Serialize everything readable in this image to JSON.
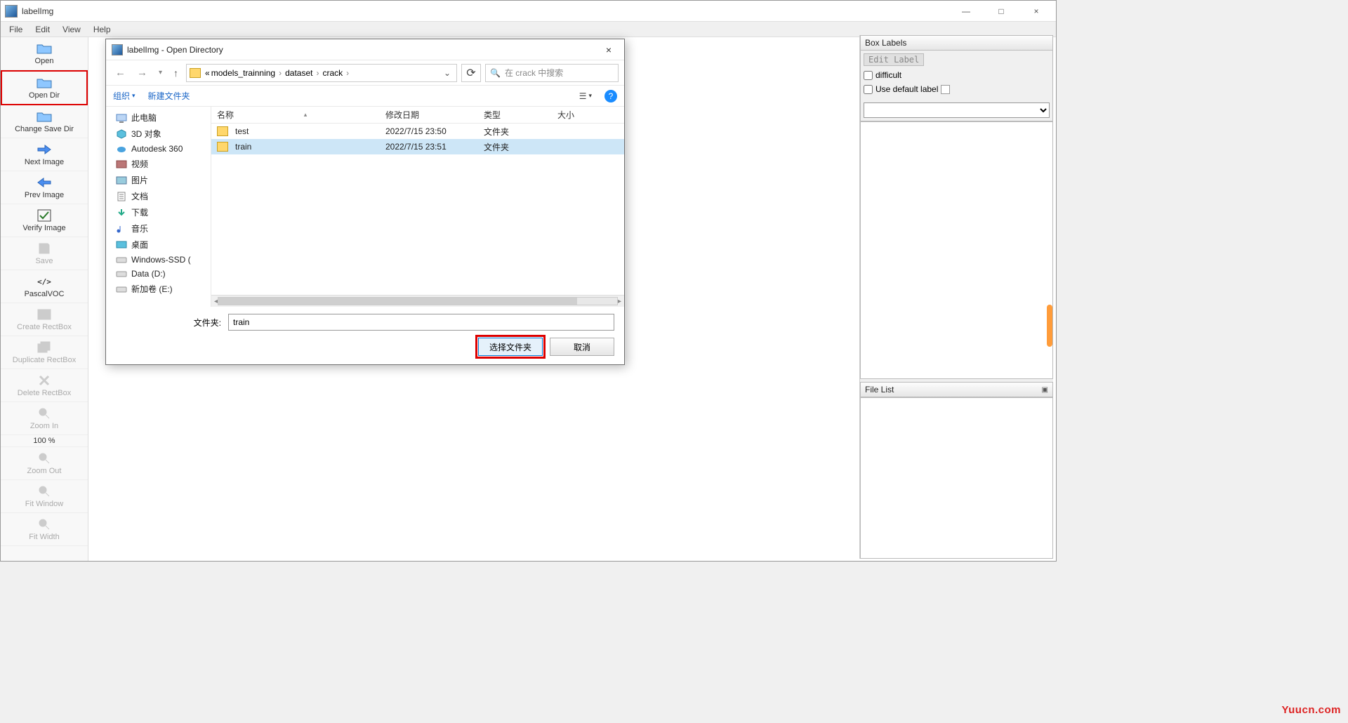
{
  "window": {
    "title": "labelImg",
    "min": "—",
    "max": "□",
    "close": "×"
  },
  "menu": {
    "file": "File",
    "edit": "Edit",
    "view": "View",
    "help": "Help"
  },
  "tools": {
    "open": "Open",
    "open_dir": "Open Dir",
    "change_save_dir": "Change Save Dir",
    "next_image": "Next Image",
    "prev_image": "Prev Image",
    "verify_image": "Verify Image",
    "save": "Save",
    "pascalvoc": "PascalVOC",
    "create_rectbox": "Create RectBox",
    "duplicate_rectbox": "Duplicate RectBox",
    "delete_rectbox": "Delete RectBox",
    "zoom_in": "Zoom In",
    "zoom_pct": "100 %",
    "zoom_out": "Zoom Out",
    "fit_window": "Fit Window",
    "fit_width": "Fit Width"
  },
  "right": {
    "box_labels": "Box Labels",
    "edit_label": "Edit Label",
    "difficult": "difficult",
    "use_default_label": "Use default label",
    "file_list": "File List"
  },
  "dialog": {
    "title": "labelImg - Open Directory",
    "breadcrumb": {
      "pre": "«",
      "p1": "models_trainning",
      "p2": "dataset",
      "p3": "crack"
    },
    "search_placeholder": "在 crack 中搜索",
    "organize": "组织",
    "new_folder": "新建文件夹",
    "columns": {
      "name": "名称",
      "date": "修改日期",
      "type": "类型",
      "size": "大小"
    },
    "tree": [
      {
        "label": "此电脑",
        "icon": "pc"
      },
      {
        "label": "3D 对象",
        "icon": "3d"
      },
      {
        "label": "Autodesk 360",
        "icon": "cloud"
      },
      {
        "label": "视频",
        "icon": "video"
      },
      {
        "label": "图片",
        "icon": "image"
      },
      {
        "label": "文档",
        "icon": "doc"
      },
      {
        "label": "下载",
        "icon": "download"
      },
      {
        "label": "音乐",
        "icon": "music"
      },
      {
        "label": "桌面",
        "icon": "desktop"
      },
      {
        "label": "Windows-SSD (",
        "icon": "disk"
      },
      {
        "label": "Data (D:)",
        "icon": "disk"
      },
      {
        "label": "新加卷 (E:)",
        "icon": "disk"
      }
    ],
    "rows": [
      {
        "name": "test",
        "date": "2022/7/15 23:50",
        "type": "文件夹",
        "selected": false
      },
      {
        "name": "train",
        "date": "2022/7/15 23:51",
        "type": "文件夹",
        "selected": true
      }
    ],
    "folder_label": "文件夹:",
    "folder_value": "train",
    "ok": "选择文件夹",
    "cancel": "取消"
  },
  "watermark": "Yuucn.com"
}
